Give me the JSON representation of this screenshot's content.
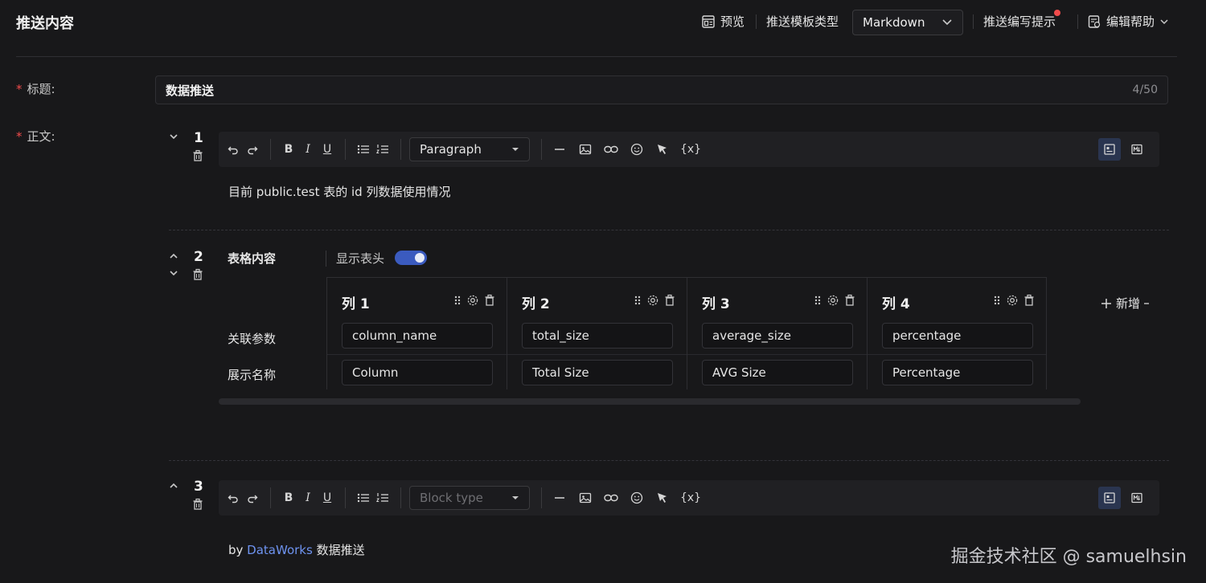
{
  "header": {
    "title": "推送内容",
    "preview": "预览",
    "template_type_label": "推送模板类型",
    "template_type_value": "Markdown",
    "writing_tips": "推送编写提示",
    "edit_help": "编辑帮助"
  },
  "form": {
    "title_label": "标题:",
    "title_value": "数据推送",
    "title_counter": "4/50",
    "body_label": "正文:"
  },
  "blocks": [
    {
      "number": "1",
      "block_type": "Paragraph",
      "text": "目前 public.test 表的 id 列数据使用情况"
    },
    {
      "number": "2",
      "label": "表格内容",
      "show_header_label": "显示表头",
      "show_header": true,
      "row_labels": [
        "关联参数",
        "展示名称"
      ],
      "columns": [
        {
          "header": "列 1",
          "param": "column_name",
          "display": "Column"
        },
        {
          "header": "列 2",
          "param": "total_size",
          "display": "Total Size"
        },
        {
          "header": "列 3",
          "param": "average_size",
          "display": "AVG Size"
        },
        {
          "header": "列 4",
          "param": "percentage",
          "display": "Percentage"
        }
      ],
      "add_label": "新增"
    },
    {
      "number": "3",
      "block_type_placeholder": "Block type",
      "text_prefix": "by ",
      "link_text": "DataWorks",
      "text_suffix": " 数据推送"
    }
  ],
  "toolbar": {
    "bold": "B",
    "italic": "I",
    "underline": "U",
    "variable": "{x}"
  },
  "watermark": "掘金技术社区 @ samuelhsin",
  "colors": {
    "background": "#18181a",
    "accent": "#3b5bbf",
    "link": "#6e93f0",
    "required": "#f04b4b"
  }
}
